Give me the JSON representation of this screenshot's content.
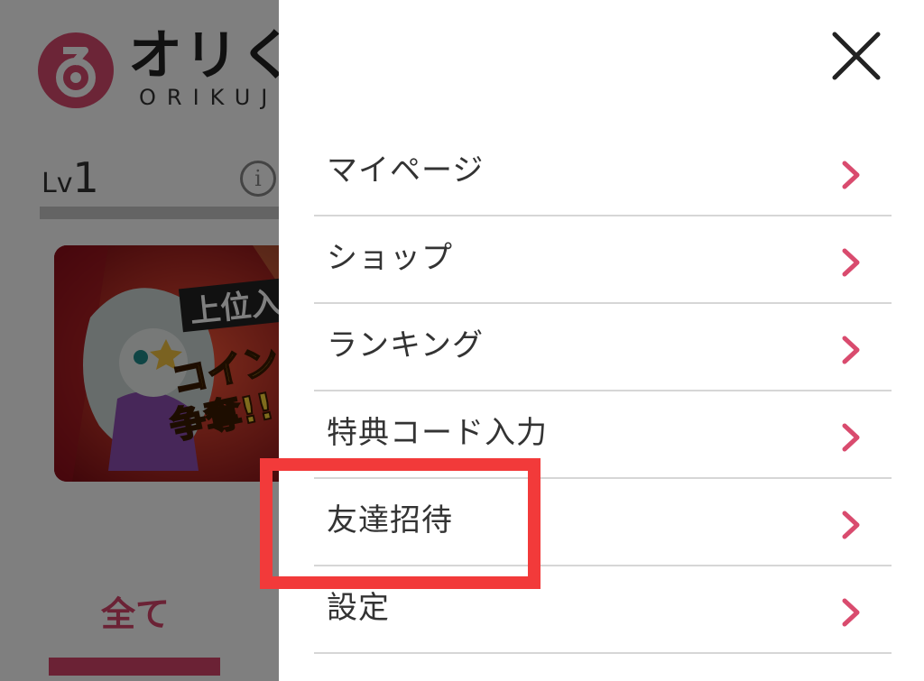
{
  "background_page": {
    "logo": {
      "text_main": "オリく",
      "text_sub": "ORIKUJ"
    },
    "level": {
      "label": "Lv",
      "value": "1"
    },
    "banner": {
      "text_top": "上位入",
      "text_mid": "コイン",
      "text_bot": "争奪!!"
    },
    "tab_all_label": "全て"
  },
  "drawer": {
    "close_icon": "close-icon",
    "items": [
      {
        "label": "マイページ",
        "icon": "chevron-right-icon"
      },
      {
        "label": "ショップ",
        "icon": "chevron-right-icon"
      },
      {
        "label": "ランキング",
        "icon": "chevron-right-icon"
      },
      {
        "label": "特典コード入力",
        "icon": "chevron-right-icon"
      },
      {
        "label": "友達招待",
        "icon": "chevron-right-icon"
      },
      {
        "label": "設定",
        "icon": "chevron-right-icon"
      }
    ]
  },
  "colors": {
    "accent": "#d6456a",
    "chevron": "#d94b6e",
    "highlight": "#f23a3a",
    "divider": "#d6d6d6",
    "text": "#333333"
  }
}
